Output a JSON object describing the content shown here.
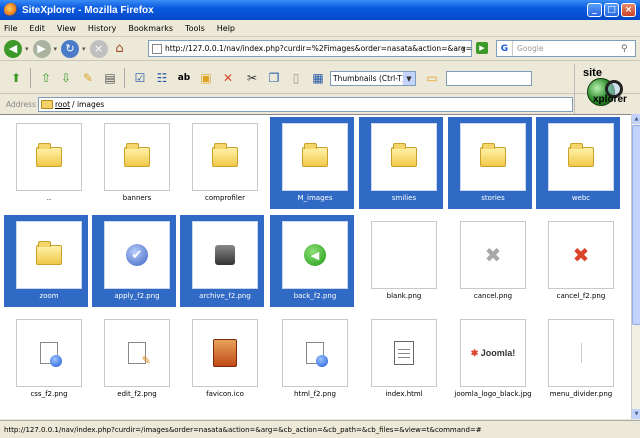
{
  "window": {
    "title": "SiteXplorer - Mozilla Firefox"
  },
  "menu": [
    "File",
    "Edit",
    "View",
    "History",
    "Bookmarks",
    "Tools",
    "Help"
  ],
  "nav": {
    "url": "http://127.0.0.1/nav/index.php?curdir=%2Fimages&order=nasata&action=&arg=&cb_",
    "search_placeholder": "Google"
  },
  "toolbar": {
    "view_mode": "Thumbnails (Ctrl-T)",
    "filter_value": ""
  },
  "logo": {
    "top": "site",
    "bottom": "xplorer"
  },
  "address": {
    "label": "Address",
    "root": "root",
    "path": "/ images"
  },
  "items": [
    {
      "name": "..",
      "kind": "folder",
      "selected": false
    },
    {
      "name": "banners",
      "kind": "folder",
      "selected": false
    },
    {
      "name": "comprofiler",
      "kind": "folder",
      "selected": false
    },
    {
      "name": "M_images",
      "kind": "folder",
      "selected": true
    },
    {
      "name": "smilies",
      "kind": "folder",
      "selected": true
    },
    {
      "name": "stories",
      "kind": "folder",
      "selected": true
    },
    {
      "name": "webc",
      "kind": "folder",
      "selected": true
    },
    {
      "name": "zoom",
      "kind": "folder",
      "selected": true
    },
    {
      "name": "apply_f2.png",
      "kind": "apply",
      "selected": true
    },
    {
      "name": "archive_f2.png",
      "kind": "archive",
      "selected": true
    },
    {
      "name": "back_f2.png",
      "kind": "back",
      "selected": true
    },
    {
      "name": "blank.png",
      "kind": "blank",
      "selected": false
    },
    {
      "name": "cancel.png",
      "kind": "cancel",
      "selected": false
    },
    {
      "name": "cancel_f2.png",
      "kind": "cancel-red",
      "selected": false
    },
    {
      "name": "css_f2.png",
      "kind": "doc-globe",
      "selected": false
    },
    {
      "name": "edit_f2.png",
      "kind": "doc-edit",
      "selected": false
    },
    {
      "name": "favicon.ico",
      "kind": "favicon",
      "selected": false
    },
    {
      "name": "html_f2.png",
      "kind": "doc-globe",
      "selected": false
    },
    {
      "name": "index.html",
      "kind": "html",
      "selected": false
    },
    {
      "name": "joomla_logo_black.jpg",
      "kind": "joomla",
      "selected": false
    },
    {
      "name": "menu_divider.png",
      "kind": "divider",
      "selected": false
    }
  ],
  "joomla_text": {
    "mark": "✱",
    "word": "Joomla!"
  },
  "status": "http://127.0.0.1/nav/index.php?curdir=/images&order=nasata&action=&arg=&cb_action=&cb_path=&cb_files=&view=t&command=#",
  "colors": {
    "selection": "#316ac5",
    "titlebar": "#0a5ae0"
  }
}
